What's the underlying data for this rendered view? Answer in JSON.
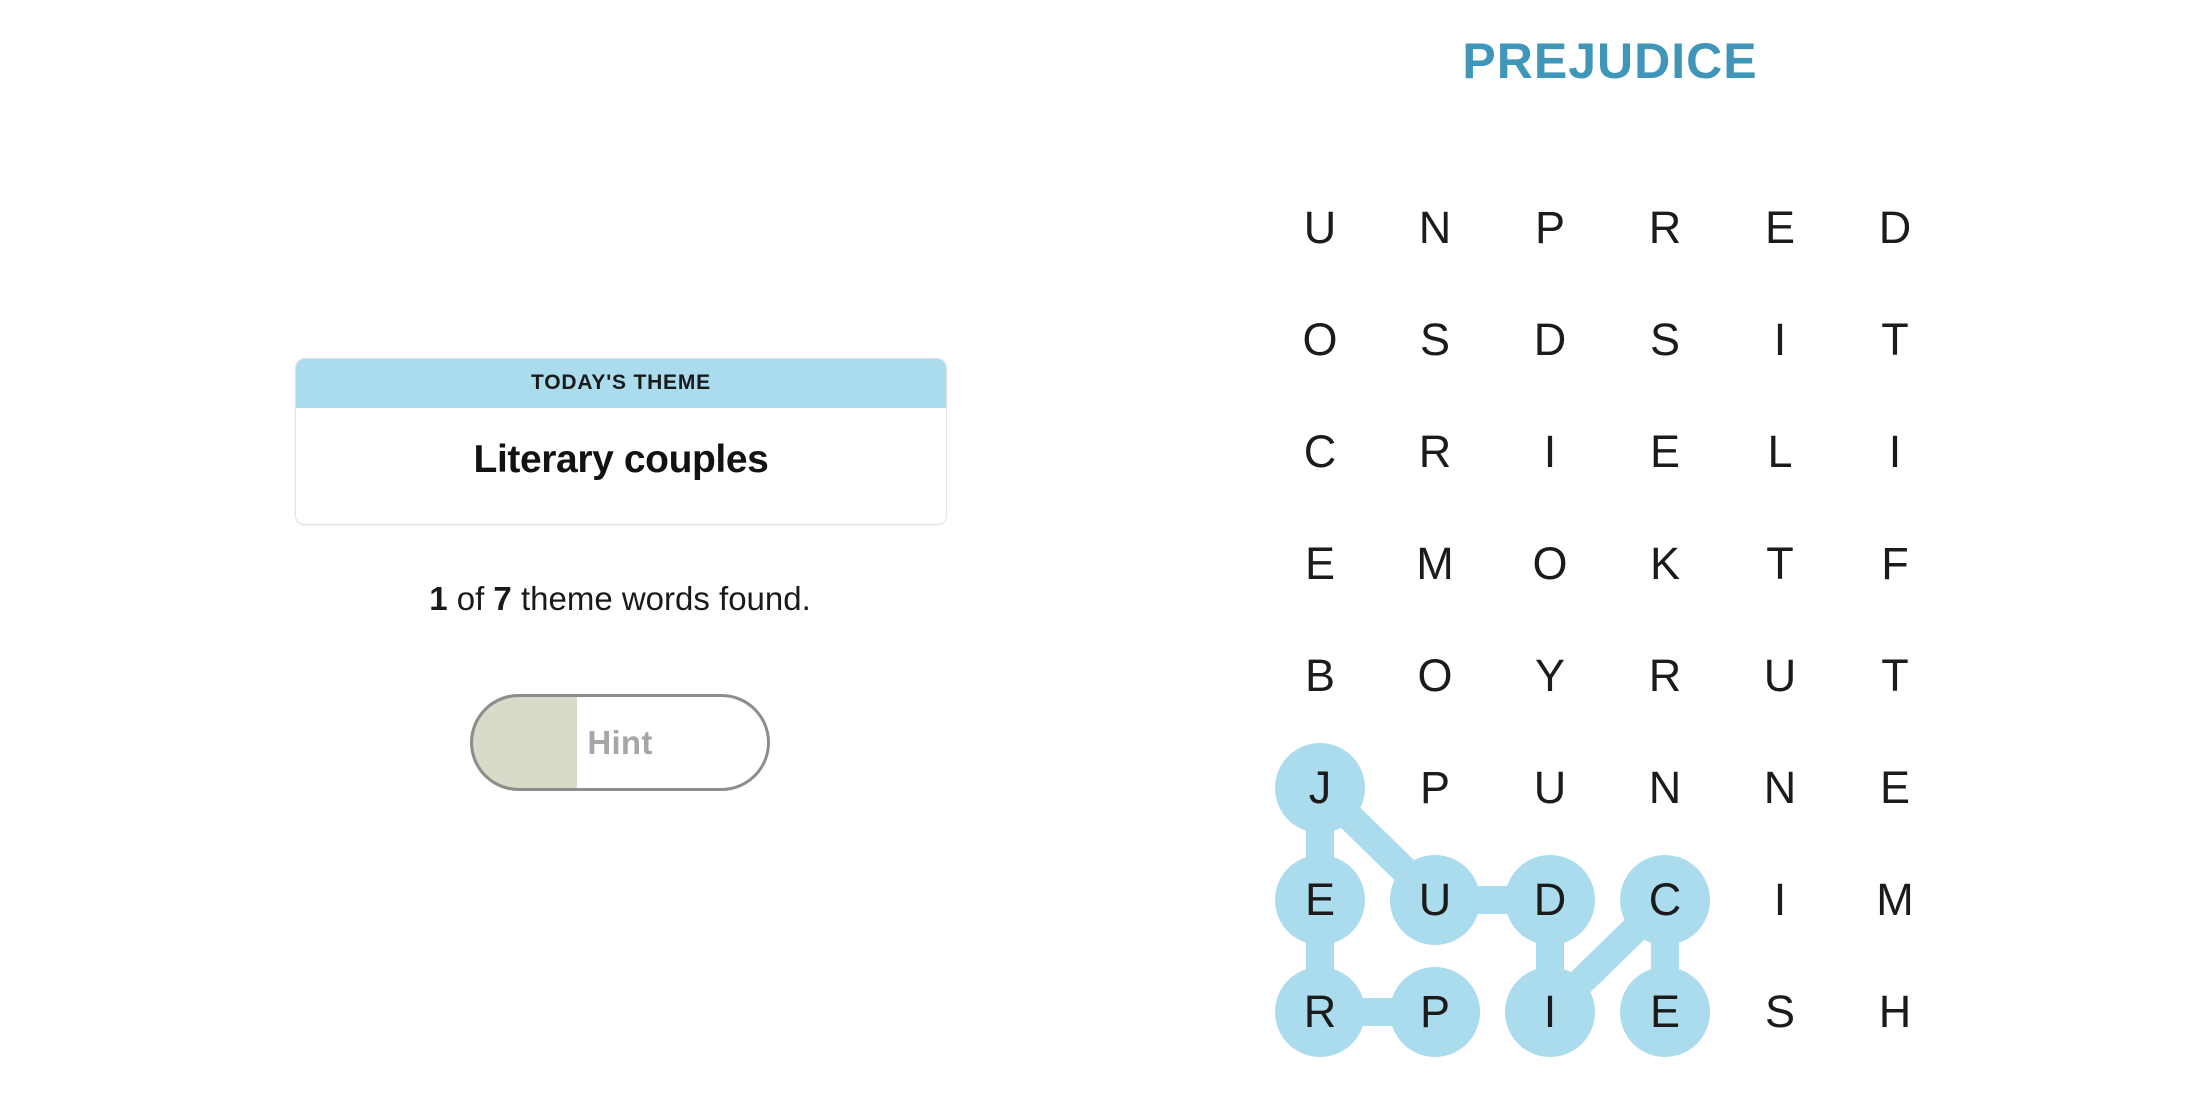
{
  "puzzle": {
    "title": "PREJUDICE",
    "title_color": "#3f96b9",
    "highlight_color": "#aadcee",
    "letter_color": "#1b1b1b",
    "rows": 8,
    "cols": 6,
    "grid": [
      [
        "U",
        "N",
        "P",
        "R",
        "E",
        "D"
      ],
      [
        "O",
        "S",
        "D",
        "S",
        "I",
        "T"
      ],
      [
        "C",
        "R",
        "I",
        "E",
        "L",
        "I"
      ],
      [
        "E",
        "M",
        "O",
        "K",
        "T",
        "F"
      ],
      [
        "B",
        "O",
        "Y",
        "R",
        "U",
        "T"
      ],
      [
        "J",
        "P",
        "U",
        "N",
        "N",
        "E"
      ],
      [
        "E",
        "U",
        "D",
        "C",
        "I",
        "M"
      ],
      [
        "R",
        "P",
        "I",
        "E",
        "S",
        "H"
      ]
    ],
    "found_cells": [
      {
        "row": 5,
        "col": 0
      },
      {
        "row": 6,
        "col": 0
      },
      {
        "row": 6,
        "col": 1
      },
      {
        "row": 6,
        "col": 2
      },
      {
        "row": 6,
        "col": 3
      },
      {
        "row": 7,
        "col": 0
      },
      {
        "row": 7,
        "col": 1
      },
      {
        "row": 7,
        "col": 2
      },
      {
        "row": 7,
        "col": 3
      }
    ],
    "found_links": [
      {
        "from": {
          "row": 5,
          "col": 0
        },
        "to": {
          "row": 6,
          "col": 0
        }
      },
      {
        "from": {
          "row": 5,
          "col": 0
        },
        "to": {
          "row": 6,
          "col": 1
        }
      },
      {
        "from": {
          "row": 6,
          "col": 0
        },
        "to": {
          "row": 7,
          "col": 0
        }
      },
      {
        "from": {
          "row": 6,
          "col": 1
        },
        "to": {
          "row": 6,
          "col": 2
        }
      },
      {
        "from": {
          "row": 6,
          "col": 2
        },
        "to": {
          "row": 7,
          "col": 2
        }
      },
      {
        "from": {
          "row": 7,
          "col": 0
        },
        "to": {
          "row": 7,
          "col": 1
        }
      },
      {
        "from": {
          "row": 7,
          "col": 2
        },
        "to": {
          "row": 6,
          "col": 3
        }
      },
      {
        "from": {
          "row": 6,
          "col": 3
        },
        "to": {
          "row": 7,
          "col": 3
        }
      }
    ]
  },
  "theme_card": {
    "header_label": "TODAY'S THEME",
    "theme_title": "Literary couples",
    "header_color": "#aadced"
  },
  "progress": {
    "found_count": "1",
    "middle_text": " of ",
    "total_count": "7",
    "suffix_text": " theme words found."
  },
  "hint": {
    "label": "Hint",
    "fill_percent": 35,
    "fill_color": "#d9dac9"
  }
}
